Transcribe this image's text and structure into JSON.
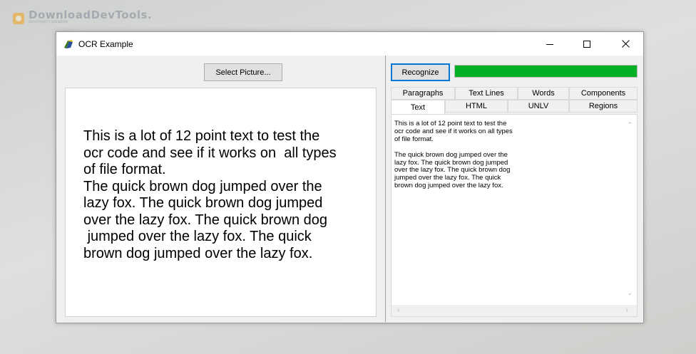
{
  "watermark": {
    "title": "DownloadDevTools.",
    "subtitle": "developer's paradise"
  },
  "window": {
    "title": "OCR Example"
  },
  "left": {
    "select_button": "Select Picture...",
    "image_text": "This is a lot of 12 point text to test the\nocr code and see if it works on  all types\nof file format.\nThe quick brown dog jumped over the\nlazy fox. The quick brown dog jumped\nover the lazy fox. The quick brown dog\n jumped over the lazy fox. The quick\nbrown dog jumped over the lazy fox."
  },
  "right": {
    "recognize_button": "Recognize",
    "progress": 1.0,
    "progress_color": "#06b025",
    "tabs_row1": [
      "Paragraphs",
      "Text Lines",
      "Words",
      "Components"
    ],
    "tabs_row2": [
      "Text",
      "HTML",
      "UNLV",
      "Regions"
    ],
    "active_tab": "Text",
    "output_text": "This is a lot of 12 point text to test the\nocr code and see if it works on all types\nof file format.\n\nThe quick brown dog jumped over the\nlazy fox. The quick brown dog jumped\nover the lazy fox. The quick brown dog\njumped over the lazy fox. The quick\nbrown dog jumped over the lazy fox."
  },
  "icons": {
    "app": "app-icon",
    "minimize": "minimize-icon",
    "maximize": "maximize-icon",
    "close": "close-icon"
  }
}
